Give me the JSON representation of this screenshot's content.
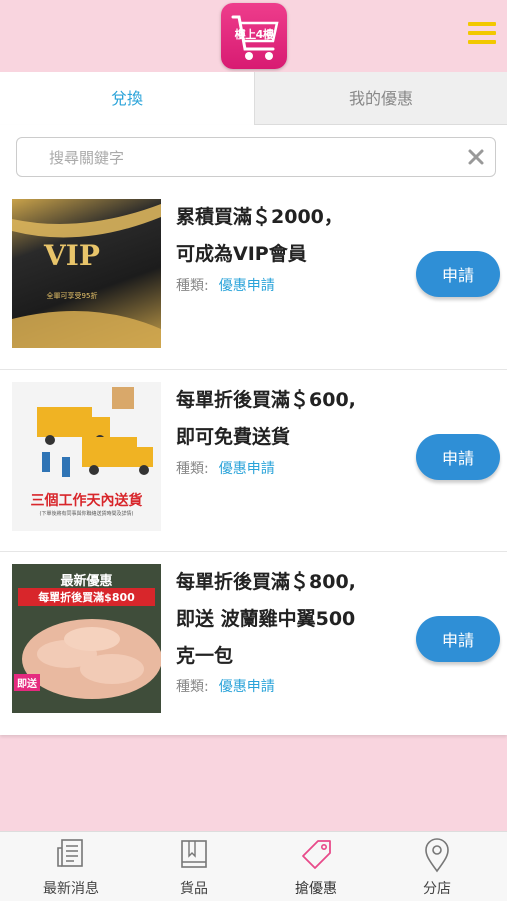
{
  "header": {
    "logo_text": "樓上4樓",
    "menu_icon": "hamburger-icon",
    "accent_color": "#f2c800",
    "brand_color": "#e52a7f"
  },
  "tabs": [
    {
      "label": "兌換",
      "active": true
    },
    {
      "label": "我的優惠",
      "active": false
    }
  ],
  "search": {
    "placeholder": "搜尋關鍵字",
    "value": "",
    "clear_icon": "x-icon"
  },
  "offers": [
    {
      "title_line1": "累積買滿＄2000，",
      "title_line2": "可成為VIP會員",
      "title_line3": "",
      "type_label": "種類:",
      "type_value": "優惠申請",
      "button_label": "申請",
      "image_text": "VIP",
      "image_subtext": "全單可享受95折"
    },
    {
      "title_line1": "每單折後買滿＄600,",
      "title_line2": "即可免費送貨",
      "title_line3": "",
      "type_label": "種類:",
      "type_value": "優惠申請",
      "button_label": "申請",
      "image_text": "三個工作天內送貨",
      "image_subtext": "(下單後將有同事與你聯絡送貨時間及詳情)"
    },
    {
      "title_line1": "每單折後買滿＄800,",
      "title_line2": "即送 波蘭雞中翼500",
      "title_line3": "克一包",
      "type_label": "種類:",
      "type_value": "優惠申請",
      "button_label": "申請",
      "image_text": "最新優惠",
      "image_subtext": "每單折後買滿$800",
      "image_badge": "即送"
    }
  ],
  "bottom_nav": [
    {
      "label": "最新消息",
      "icon": "newspaper-icon",
      "active": false
    },
    {
      "label": "貨品",
      "icon": "book-icon",
      "active": false
    },
    {
      "label": "搶優惠",
      "icon": "tag-icon",
      "active": true
    },
    {
      "label": "分店",
      "icon": "location-pin-icon",
      "active": false
    }
  ],
  "colors": {
    "background": "#f9d5df",
    "link_blue": "#2aa3d9",
    "button_blue": "#2f8fd6",
    "active_tab_icon": "#e84a8a"
  }
}
